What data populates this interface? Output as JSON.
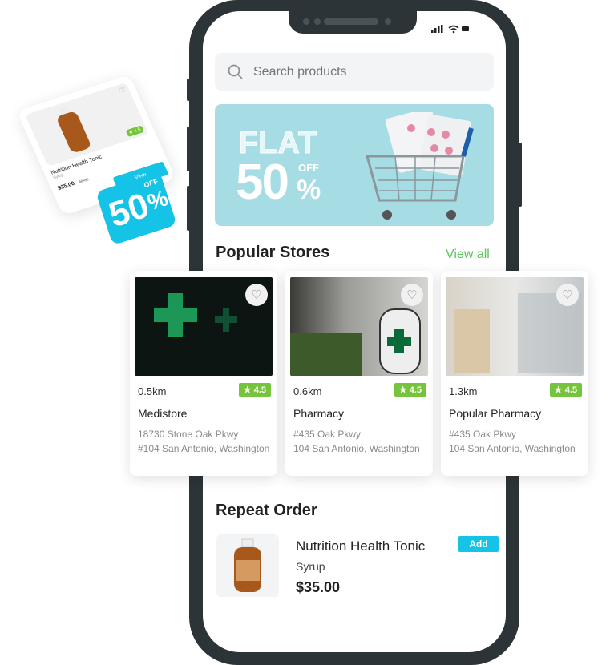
{
  "status": {
    "icons": [
      "signal-icon",
      "wifi-icon",
      "battery-icon"
    ]
  },
  "search": {
    "placeholder": "Search products"
  },
  "banner": {
    "line1": "FLAT",
    "line2": "50",
    "off": "OFF",
    "percent": "%"
  },
  "popular": {
    "title": "Popular Stores",
    "view_all": "View all",
    "stores": [
      {
        "distance": "0.5km",
        "rating": "4.5",
        "name": "Medistore",
        "addr1": "18730 Stone Oak Pkwy",
        "addr2": "#104 San Antonio, Washington"
      },
      {
        "distance": "0.6km",
        "rating": "4.5",
        "name": "Pharmacy",
        "addr1": "#435 Oak Pkwy",
        "addr2": "104 San Antonio, Washington"
      },
      {
        "distance": "1.3km",
        "rating": "4.5",
        "name": "Popular Pharmacy",
        "addr1": "#435 Oak Pkwy",
        "addr2": "104 San Antonio, Washington"
      }
    ]
  },
  "repeat": {
    "title": "Repeat Order",
    "product": "Nutrition Health Tonic",
    "type": "Syrup",
    "price": "$35.00",
    "add": "Add"
  },
  "mini_card": {
    "rating": "4.5",
    "name": "Nutrition Health Tonic",
    "type": "Syrup",
    "price": "$35.00",
    "old_price": "$5.99",
    "view": "View"
  },
  "promo": {
    "value": "50",
    "off": "OFF",
    "percent": "%"
  },
  "colors": {
    "accent": "#14c3e6",
    "green": "#76c43c",
    "frame": "#2d3438"
  }
}
